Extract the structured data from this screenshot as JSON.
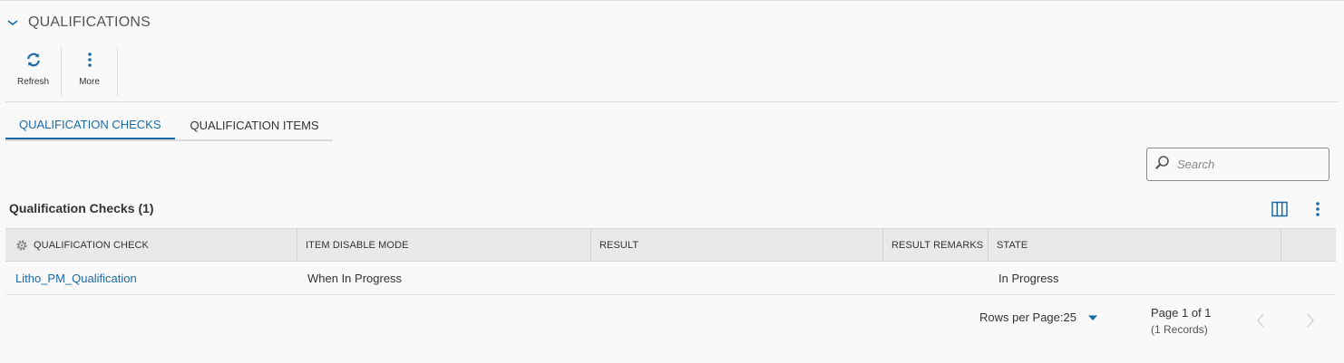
{
  "section": {
    "title": "QUALIFICATIONS"
  },
  "toolbar": {
    "refresh_label": "Refresh",
    "more_label": "More"
  },
  "tabs": [
    {
      "label": "QUALIFICATION CHECKS",
      "active": true
    },
    {
      "label": "QUALIFICATION ITEMS",
      "active": false
    }
  ],
  "search": {
    "placeholder": "Search"
  },
  "grid": {
    "title": "Qualification Checks",
    "count": "(1)",
    "columns": [
      "QUALIFICATION CHECK",
      "ITEM DISABLE MODE",
      "RESULT",
      "RESULT REMARKS",
      "STATE"
    ],
    "rows": [
      {
        "qualification_check": "Litho_PM_Qualification",
        "item_disable_mode": "When In Progress",
        "result": "",
        "result_remarks": "",
        "state": "In Progress"
      }
    ]
  },
  "pagination": {
    "rows_per_page_label": "Rows per Page:",
    "rows_per_page_value": "25",
    "page_text": "Page 1 of 1",
    "records_text": "(1 Records)"
  },
  "colors": {
    "accent": "#1a6aa6",
    "header_bg": "#e9e9e9",
    "page_bg": "#f9f9f9"
  },
  "icons": [
    "chevron-down-icon",
    "refresh-icon",
    "more-vertical-icon",
    "search-icon",
    "columns-icon",
    "gear-icon",
    "caret-down-icon",
    "chevron-left-icon",
    "chevron-right-icon"
  ]
}
